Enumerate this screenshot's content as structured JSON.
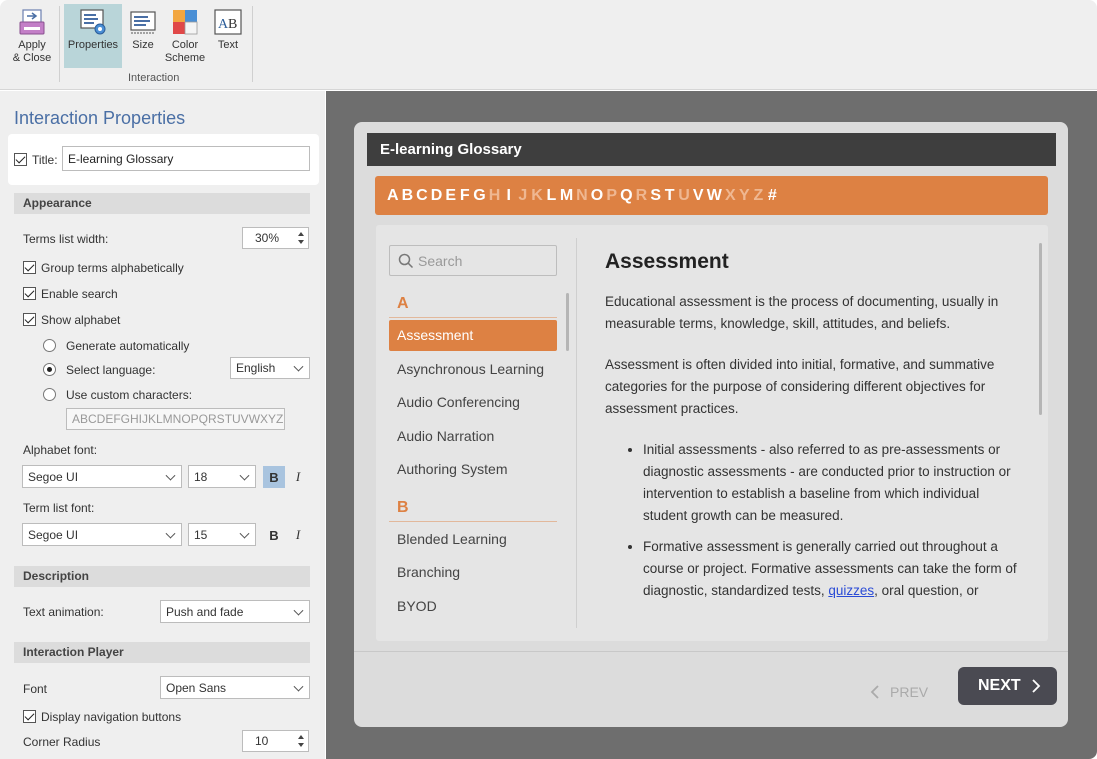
{
  "ribbon": {
    "buttons": [
      {
        "label": "Apply\n& Close",
        "icon": "apply-close-icon"
      },
      {
        "label": "Properties",
        "icon": "properties-icon",
        "active": true
      },
      {
        "label": "Size",
        "icon": "size-icon"
      },
      {
        "label": "Color\nScheme",
        "icon": "color-scheme-icon"
      },
      {
        "label": "Text",
        "icon": "text-icon"
      }
    ],
    "group_label": "Interaction"
  },
  "panel": {
    "title": "Interaction Properties",
    "title_checkbox_label": "Title:",
    "title_value": "E-learning Glossary",
    "appearance": {
      "header": "Appearance",
      "terms_width_label": "Terms list width:",
      "terms_width_value": "30%",
      "group_terms_label": "Group terms alphabetically",
      "enable_search_label": "Enable search",
      "show_alphabet_label": "Show alphabet",
      "generate_auto_label": "Generate automatically",
      "select_language_label": "Select language:",
      "language_value": "English",
      "custom_chars_label": "Use custom characters:",
      "custom_chars_value": "ABCDEFGHIJKLMNOPQRSTUVWXYZ",
      "alphabet_font_label": "Alphabet font:",
      "alphabet_font_value": "Segoe UI",
      "alphabet_size_value": "18",
      "term_font_label": "Term list font:",
      "term_font_value": "Segoe UI",
      "term_size_value": "15",
      "bold_glyph": "B",
      "italic_glyph": "I"
    },
    "description": {
      "header": "Description",
      "text_animation_label": "Text animation:",
      "text_animation_value": "Push and fade"
    },
    "player": {
      "header": "Interaction Player",
      "font_label": "Font",
      "font_value": "Open Sans",
      "display_nav_label": "Display navigation buttons",
      "corner_radius_label": "Corner Radius",
      "corner_radius_value": "10"
    }
  },
  "preview": {
    "title": "E-learning Glossary",
    "alphabet": [
      {
        "c": "A",
        "on": true
      },
      {
        "c": "B",
        "on": true
      },
      {
        "c": "C",
        "on": true
      },
      {
        "c": "D",
        "on": true
      },
      {
        "c": "E",
        "on": true
      },
      {
        "c": "F",
        "on": true
      },
      {
        "c": "G",
        "on": true
      },
      {
        "c": "H",
        "on": false
      },
      {
        "c": "I",
        "on": true
      },
      {
        "c": "J",
        "on": false
      },
      {
        "c": "K",
        "on": false
      },
      {
        "c": "L",
        "on": true
      },
      {
        "c": "M",
        "on": true
      },
      {
        "c": "N",
        "on": false
      },
      {
        "c": "O",
        "on": true
      },
      {
        "c": "P",
        "on": false
      },
      {
        "c": "Q",
        "on": true
      },
      {
        "c": "R",
        "on": false
      },
      {
        "c": "S",
        "on": true
      },
      {
        "c": "T",
        "on": true
      },
      {
        "c": "U",
        "on": false
      },
      {
        "c": "V",
        "on": true
      },
      {
        "c": "W",
        "on": true
      },
      {
        "c": "X",
        "on": false
      },
      {
        "c": "Y",
        "on": false
      },
      {
        "c": "Z",
        "on": false
      },
      {
        "c": "#",
        "on": true
      }
    ],
    "search_placeholder": "Search",
    "groups": [
      {
        "letter": "A",
        "terms": [
          "Assessment",
          "Asynchronous Learning",
          "Audio Conferencing",
          "Audio Narration",
          "Authoring System"
        ]
      },
      {
        "letter": "B",
        "terms": [
          "Blended Learning",
          "Branching",
          "BYOD"
        ]
      }
    ],
    "selected_term": "Assessment",
    "detail": {
      "heading": "Assessment",
      "p1": "Educational assessment is the process of documenting, usually in measurable terms, knowledge, skill, attitudes, and beliefs.",
      "p2": "Assessment is often divided into initial, formative, and summative categories for the purpose of considering different objectives for assessment practices.",
      "bullet1": "Initial assessments - also referred to as pre-assessments or diagnostic assessments - are conducted prior to instruction or intervention to establish a baseline from which individual student growth can be measured.",
      "bullet2_before": "Formative assessment is generally carried out throughout a course or project. Formative assessments can take the form of diagnostic, standardized tests, ",
      "bullet2_link": "quizzes",
      "bullet2_after": ", oral question, or"
    },
    "prev_label": "PREV",
    "next_label": "NEXT"
  },
  "colors": {
    "accent": "#dd8143",
    "title_blue": "#4a6fa5",
    "header_dark": "#3e3e3e",
    "active_ribbon": "#b9d5d9"
  }
}
